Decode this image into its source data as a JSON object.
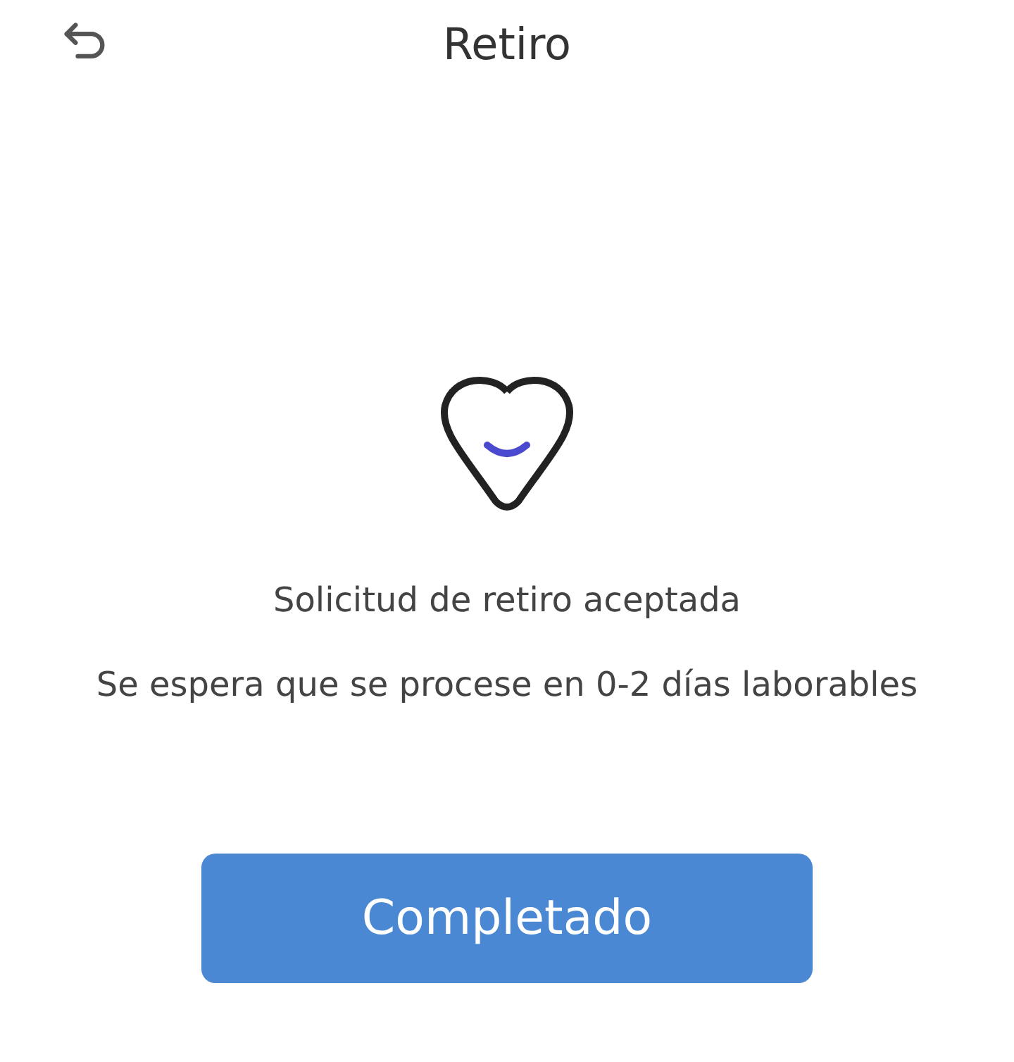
{
  "header": {
    "title": "Retiro"
  },
  "message": {
    "title": "Solicitud de retiro aceptada",
    "detail": "Se espera que se procese en 0-2 días laborables"
  },
  "button": {
    "label": "Completado"
  }
}
